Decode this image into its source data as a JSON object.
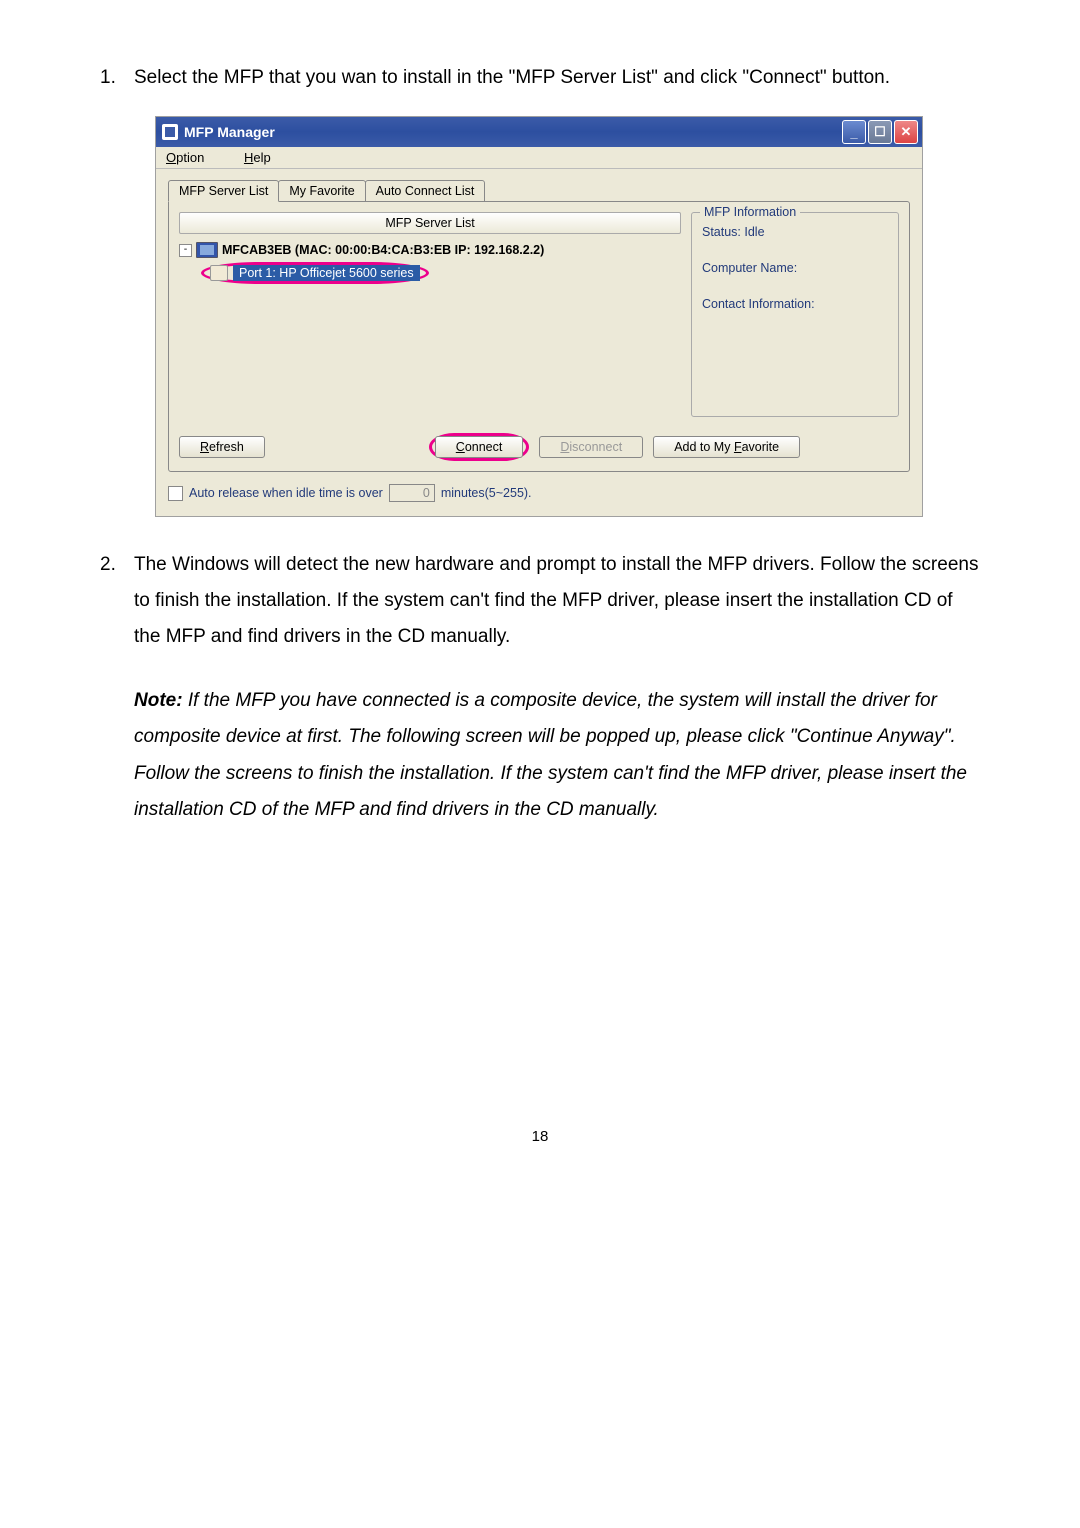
{
  "step1": {
    "num": "1.",
    "text": "Select the MFP that you wan to install in the \"MFP Server List\" and click \"Connect\" button."
  },
  "step2": {
    "num": "2.",
    "text": "The Windows will detect the new hardware and prompt to install the MFP drivers. Follow the screens to finish the installation. If the system can't find the MFP driver, please insert the installation CD of the MFP and find drivers in the CD manually."
  },
  "note": {
    "label": "Note:",
    "text": " If the MFP you have connected is a composite device, the system will install the driver for composite device at first. The following screen will be popped up, please click \"Continue Anyway\". Follow the screens to finish the installation. If the system can't find the MFP driver, please insert the installation CD of the MFP and find drivers in the CD manually."
  },
  "window": {
    "title": "MFP Manager",
    "menu": {
      "option": "Option",
      "help": "Help"
    },
    "tabs": {
      "serverList": "MFP Server List",
      "myFavorite": "My Favorite",
      "autoConnect": "Auto Connect List"
    },
    "listHeader": "MFP Server List",
    "tree": {
      "server": "MFCAB3EB (MAC: 00:00:B4:CA:B3:EB   IP: 192.168.2.2)",
      "port": "Port 1: HP Officejet 5600 series"
    },
    "info": {
      "legend": "MFP Information",
      "status": "Status: Idle",
      "computer": "Computer Name:",
      "contact": "Contact Information:"
    },
    "buttons": {
      "refresh": "Refresh",
      "connect": "Connect",
      "disconnect": "Disconnect",
      "addFav": "Add to My Favorite"
    },
    "footer": {
      "autoRelease": "Auto release when idle time is over",
      "minutes": "minutes(5~255).",
      "value": "0"
    }
  },
  "pageNumber": "18"
}
